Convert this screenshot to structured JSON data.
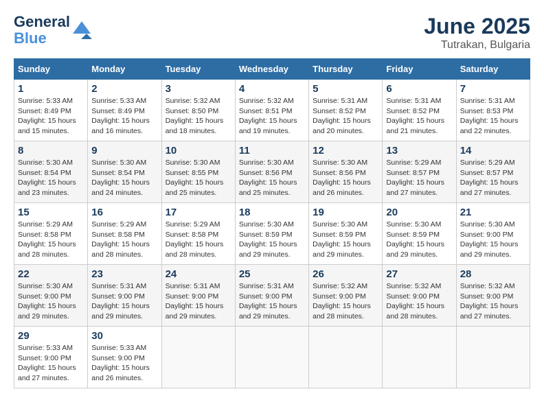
{
  "header": {
    "logo_line1": "General",
    "logo_line2": "Blue",
    "month": "June 2025",
    "location": "Tutrakan, Bulgaria"
  },
  "weekdays": [
    "Sunday",
    "Monday",
    "Tuesday",
    "Wednesday",
    "Thursday",
    "Friday",
    "Saturday"
  ],
  "weeks": [
    [
      {
        "day": "1",
        "info": "Sunrise: 5:33 AM\nSunset: 8:49 PM\nDaylight: 15 hours\nand 15 minutes."
      },
      {
        "day": "2",
        "info": "Sunrise: 5:33 AM\nSunset: 8:49 PM\nDaylight: 15 hours\nand 16 minutes."
      },
      {
        "day": "3",
        "info": "Sunrise: 5:32 AM\nSunset: 8:50 PM\nDaylight: 15 hours\nand 18 minutes."
      },
      {
        "day": "4",
        "info": "Sunrise: 5:32 AM\nSunset: 8:51 PM\nDaylight: 15 hours\nand 19 minutes."
      },
      {
        "day": "5",
        "info": "Sunrise: 5:31 AM\nSunset: 8:52 PM\nDaylight: 15 hours\nand 20 minutes."
      },
      {
        "day": "6",
        "info": "Sunrise: 5:31 AM\nSunset: 8:52 PM\nDaylight: 15 hours\nand 21 minutes."
      },
      {
        "day": "7",
        "info": "Sunrise: 5:31 AM\nSunset: 8:53 PM\nDaylight: 15 hours\nand 22 minutes."
      }
    ],
    [
      {
        "day": "8",
        "info": "Sunrise: 5:30 AM\nSunset: 8:54 PM\nDaylight: 15 hours\nand 23 minutes."
      },
      {
        "day": "9",
        "info": "Sunrise: 5:30 AM\nSunset: 8:54 PM\nDaylight: 15 hours\nand 24 minutes."
      },
      {
        "day": "10",
        "info": "Sunrise: 5:30 AM\nSunset: 8:55 PM\nDaylight: 15 hours\nand 25 minutes."
      },
      {
        "day": "11",
        "info": "Sunrise: 5:30 AM\nSunset: 8:56 PM\nDaylight: 15 hours\nand 25 minutes."
      },
      {
        "day": "12",
        "info": "Sunrise: 5:30 AM\nSunset: 8:56 PM\nDaylight: 15 hours\nand 26 minutes."
      },
      {
        "day": "13",
        "info": "Sunrise: 5:29 AM\nSunset: 8:57 PM\nDaylight: 15 hours\nand 27 minutes."
      },
      {
        "day": "14",
        "info": "Sunrise: 5:29 AM\nSunset: 8:57 PM\nDaylight: 15 hours\nand 27 minutes."
      }
    ],
    [
      {
        "day": "15",
        "info": "Sunrise: 5:29 AM\nSunset: 8:58 PM\nDaylight: 15 hours\nand 28 minutes."
      },
      {
        "day": "16",
        "info": "Sunrise: 5:29 AM\nSunset: 8:58 PM\nDaylight: 15 hours\nand 28 minutes."
      },
      {
        "day": "17",
        "info": "Sunrise: 5:29 AM\nSunset: 8:58 PM\nDaylight: 15 hours\nand 28 minutes."
      },
      {
        "day": "18",
        "info": "Sunrise: 5:30 AM\nSunset: 8:59 PM\nDaylight: 15 hours\nand 29 minutes."
      },
      {
        "day": "19",
        "info": "Sunrise: 5:30 AM\nSunset: 8:59 PM\nDaylight: 15 hours\nand 29 minutes."
      },
      {
        "day": "20",
        "info": "Sunrise: 5:30 AM\nSunset: 8:59 PM\nDaylight: 15 hours\nand 29 minutes."
      },
      {
        "day": "21",
        "info": "Sunrise: 5:30 AM\nSunset: 9:00 PM\nDaylight: 15 hours\nand 29 minutes."
      }
    ],
    [
      {
        "day": "22",
        "info": "Sunrise: 5:30 AM\nSunset: 9:00 PM\nDaylight: 15 hours\nand 29 minutes."
      },
      {
        "day": "23",
        "info": "Sunrise: 5:31 AM\nSunset: 9:00 PM\nDaylight: 15 hours\nand 29 minutes."
      },
      {
        "day": "24",
        "info": "Sunrise: 5:31 AM\nSunset: 9:00 PM\nDaylight: 15 hours\nand 29 minutes."
      },
      {
        "day": "25",
        "info": "Sunrise: 5:31 AM\nSunset: 9:00 PM\nDaylight: 15 hours\nand 29 minutes."
      },
      {
        "day": "26",
        "info": "Sunrise: 5:32 AM\nSunset: 9:00 PM\nDaylight: 15 hours\nand 28 minutes."
      },
      {
        "day": "27",
        "info": "Sunrise: 5:32 AM\nSunset: 9:00 PM\nDaylight: 15 hours\nand 28 minutes."
      },
      {
        "day": "28",
        "info": "Sunrise: 5:32 AM\nSunset: 9:00 PM\nDaylight: 15 hours\nand 27 minutes."
      }
    ],
    [
      {
        "day": "29",
        "info": "Sunrise: 5:33 AM\nSunset: 9:00 PM\nDaylight: 15 hours\nand 27 minutes."
      },
      {
        "day": "30",
        "info": "Sunrise: 5:33 AM\nSunset: 9:00 PM\nDaylight: 15 hours\nand 26 minutes."
      },
      null,
      null,
      null,
      null,
      null
    ]
  ]
}
